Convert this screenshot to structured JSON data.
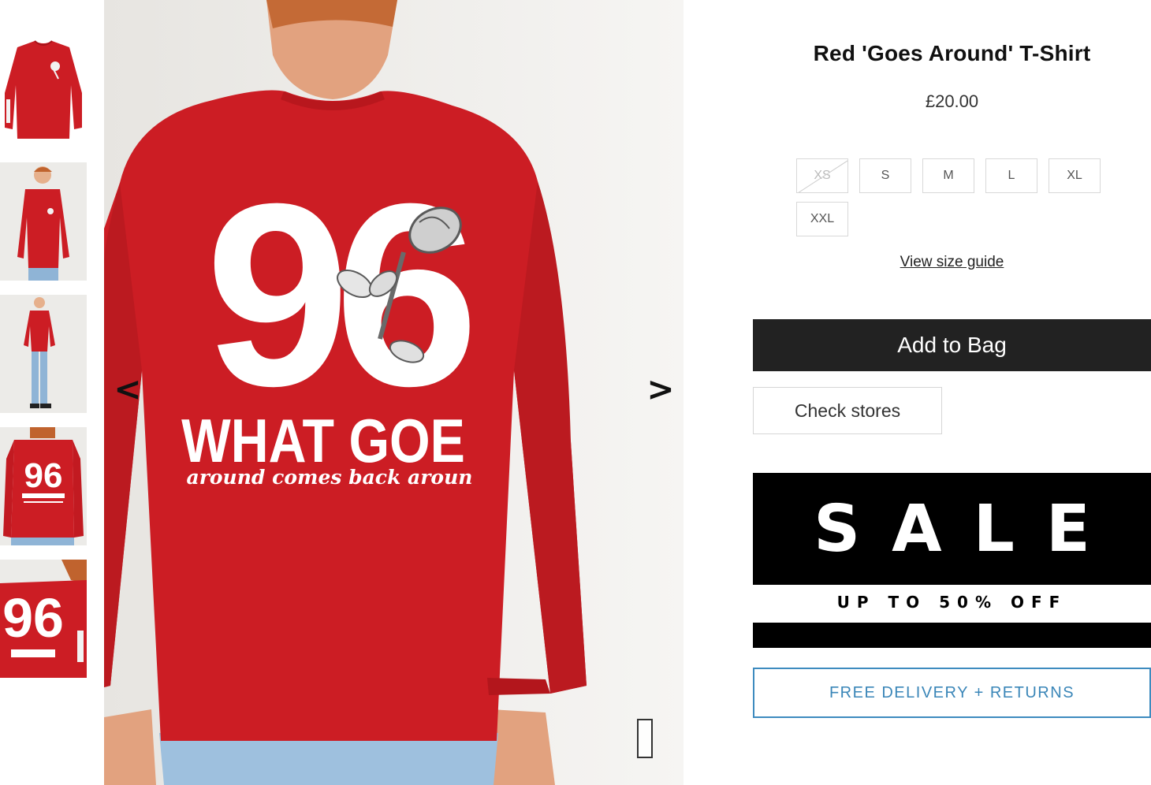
{
  "product": {
    "title": "Red 'Goes Around' T-Shirt",
    "price": "£20.00"
  },
  "sizes": [
    {
      "label": "XS",
      "available": false
    },
    {
      "label": "S",
      "available": true
    },
    {
      "label": "M",
      "available": true
    },
    {
      "label": "L",
      "available": true
    },
    {
      "label": "XL",
      "available": true
    },
    {
      "label": "XXL",
      "available": true
    }
  ],
  "size_guide_label": "View size guide",
  "buttons": {
    "add_to_bag": "Add to Bag",
    "check_stores": "Check stores"
  },
  "promo": {
    "sale_title": "SALE",
    "sale_subtitle": "UP TO 50% OFF",
    "delivery": "FREE DELIVERY + RETURNS"
  },
  "gallery": {
    "prev_arrow": "<",
    "next_arrow": ">",
    "print_number": "96",
    "print_headline": "WHAT GOE",
    "print_script": "around comes back aroun",
    "thumbnails": [
      "front-flat",
      "front-model",
      "full-length-model",
      "back-model",
      "back-closeup"
    ]
  },
  "colors": {
    "shirt_red": "#cc1d24",
    "button_dark": "#222222",
    "delivery_blue": "#3a86b8"
  }
}
